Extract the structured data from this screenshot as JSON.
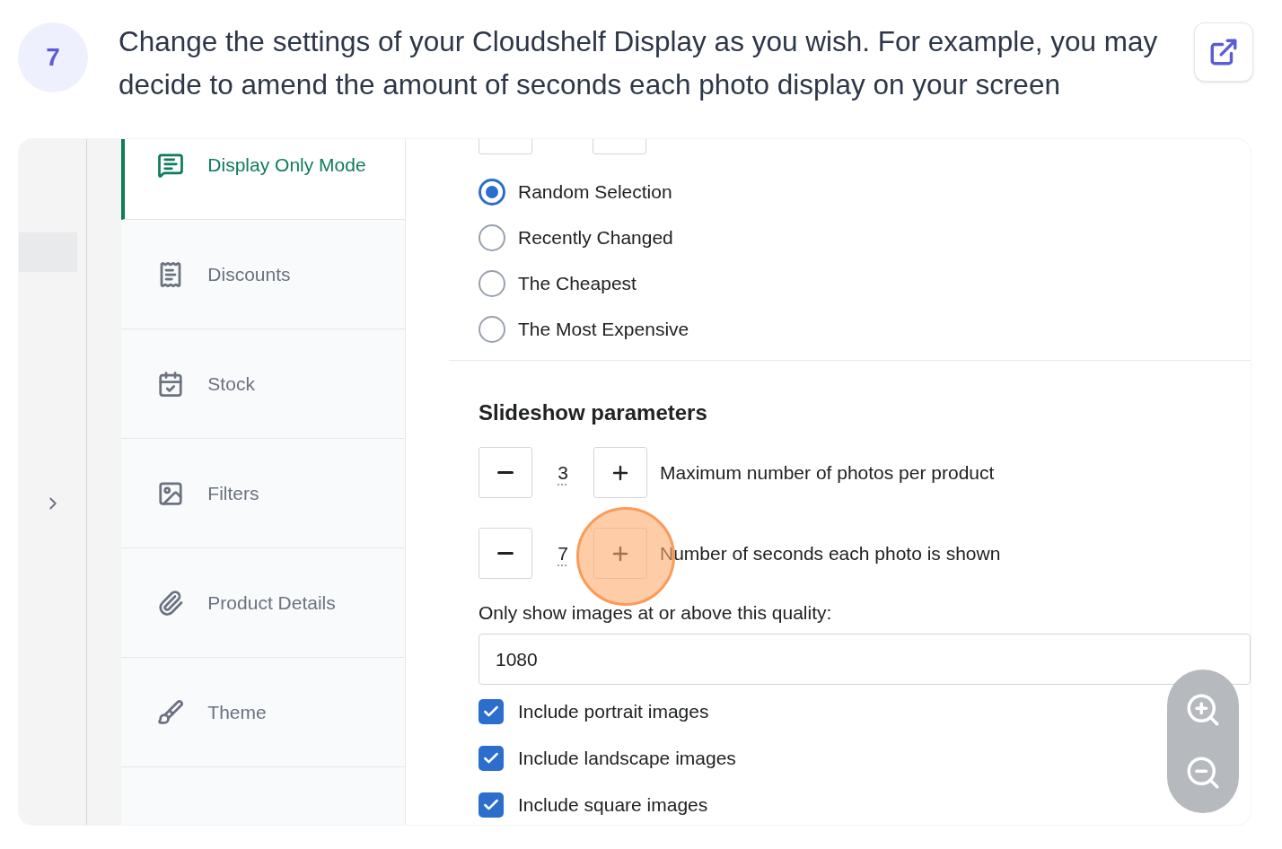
{
  "step": {
    "number": "7",
    "text": "Change the settings of your Cloudshelf Display as you wish. For example, you may decide to amend the amount of seconds each photo display on your screen"
  },
  "sidebar": {
    "items": [
      {
        "label": "Display Only Mode",
        "selected": true
      },
      {
        "label": "Discounts",
        "selected": false
      },
      {
        "label": "Stock",
        "selected": false
      },
      {
        "label": "Filters",
        "selected": false
      },
      {
        "label": "Product Details",
        "selected": false
      },
      {
        "label": "Theme",
        "selected": false
      }
    ]
  },
  "selection": {
    "options": [
      {
        "label": "Random Selection",
        "selected": true
      },
      {
        "label": "Recently Changed",
        "selected": false
      },
      {
        "label": "The Cheapest",
        "selected": false
      },
      {
        "label": "The Most Expensive",
        "selected": false
      }
    ]
  },
  "slideshow": {
    "title": "Slideshow parameters",
    "steppers": [
      {
        "value": "3",
        "label": "Maximum number of photos per product",
        "highlighted": false
      },
      {
        "value": "7",
        "label": "Number of seconds each photo is shown",
        "highlighted": true
      }
    ],
    "quality": {
      "label": "Only show images at or above this quality:",
      "value": "1080"
    },
    "checkboxes": [
      {
        "label": "Include portrait images",
        "checked": true
      },
      {
        "label": "Include landscape images",
        "checked": true
      },
      {
        "label": "Include square images",
        "checked": true
      }
    ]
  }
}
